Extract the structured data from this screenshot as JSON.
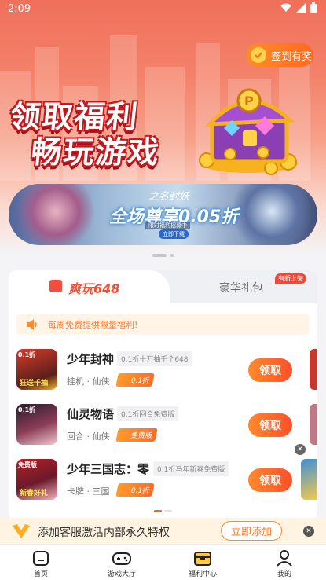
{
  "status_bar": {
    "time": "2:09"
  },
  "header": {
    "checkin_label": "签到有奖"
  },
  "hero": {
    "title_line1": "领取福利",
    "title_line2": "畅玩游戏"
  },
  "banner": {
    "logo_text": "之名封妖",
    "main_text": "全场尊享0.05折",
    "caption": "限时福利招募中",
    "button": "立即下载"
  },
  "panel": {
    "tab_active": "爽玩648",
    "tab_inactive": "豪华礼包",
    "new_badge": "有新上架",
    "notice": "每周免费提供限量福利!"
  },
  "games": [
    {
      "name": "少年封神",
      "tag": "0.1折十万抽千个648",
      "category": "挂机 · 仙侠",
      "badge": "0.1折",
      "button": "领取",
      "thumb_text": "0.1折",
      "thumb_sub": "狂送千抽"
    },
    {
      "name": "仙灵物语",
      "tag": "0.1折回合免费版",
      "category": "回合 · 仙侠",
      "badge": "免费版",
      "button": "领取",
      "thumb_text": "0.1折",
      "thumb_sub": ""
    },
    {
      "name": "少年三国志：零",
      "tag": "0.1折马年新春免费版",
      "category": "卡牌 · 三国",
      "badge": "0.1折",
      "button": "领取",
      "thumb_text": "免费版",
      "thumb_sub": "新春好礼"
    }
  ],
  "service_bar": {
    "text": "添加客服激活内部永久特权",
    "button": "立即添加"
  },
  "bottom_nav": [
    {
      "label": "首页",
      "icon": "home-icon"
    },
    {
      "label": "游戏大厅",
      "icon": "gamepad-icon"
    },
    {
      "label": "福利中心",
      "icon": "chest-icon"
    },
    {
      "label": "我的",
      "icon": "user-icon"
    }
  ],
  "colors": {
    "accent": "#ff6a21",
    "primary_red": "#f25036",
    "hero_bg": "#f0705a"
  }
}
